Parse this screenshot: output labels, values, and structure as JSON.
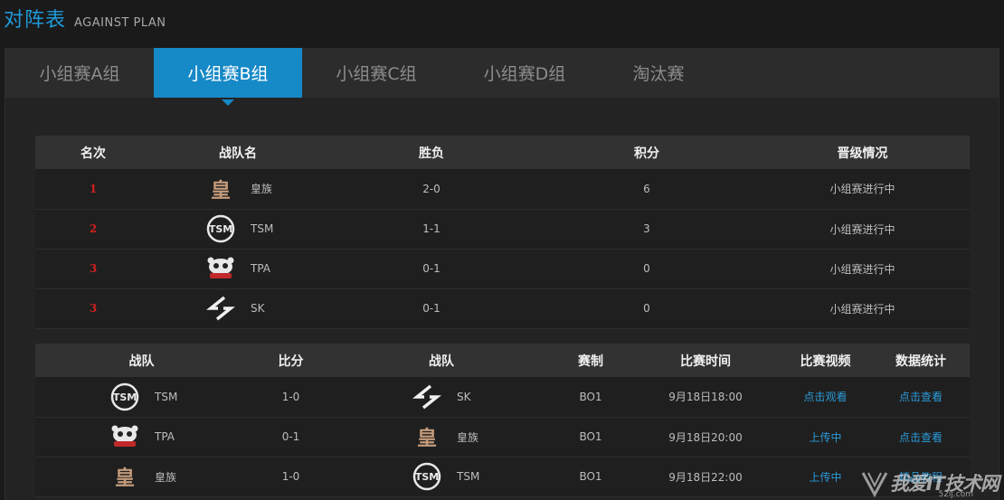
{
  "header": {
    "title": "对阵表",
    "subtitle": "AGAINST PLAN"
  },
  "tabs": [
    {
      "label": "小组赛A组",
      "active": false
    },
    {
      "label": "小组赛B组",
      "active": true
    },
    {
      "label": "小组赛C组",
      "active": false
    },
    {
      "label": "小组赛D组",
      "active": false
    },
    {
      "label": "淘汰赛",
      "active": false
    }
  ],
  "standings": {
    "headers": [
      "名次",
      "战队名",
      "胜负",
      "积分",
      "晋级情况"
    ],
    "rows": [
      {
        "rank": "1",
        "team": "皇族",
        "logo": "rng-logo-icon",
        "record": "2-0",
        "points": "6",
        "status": "小组赛进行中"
      },
      {
        "rank": "2",
        "team": "TSM",
        "logo": "tsm-logo-icon",
        "record": "1-1",
        "points": "3",
        "status": "小组赛进行中"
      },
      {
        "rank": "3",
        "team": "TPA",
        "logo": "tpa-logo-icon",
        "record": "0-1",
        "points": "0",
        "status": "小组赛进行中"
      },
      {
        "rank": "3",
        "team": "SK",
        "logo": "sk-logo-icon",
        "record": "0-1",
        "points": "0",
        "status": "小组赛进行中"
      }
    ]
  },
  "matches": {
    "headers": [
      "战队",
      "比分",
      "战队",
      "赛制",
      "比赛时间",
      "比赛视频",
      "数据统计"
    ],
    "rows": [
      {
        "team_a": "TSM",
        "logo_a": "tsm-logo-icon",
        "score": "1-0",
        "team_b": "SK",
        "logo_b": "sk-logo-icon",
        "format": "BO1",
        "time": "9月18日18:00",
        "video": "点击观看",
        "stats": "点击查看"
      },
      {
        "team_a": "TPA",
        "logo_a": "tpa-logo-icon",
        "score": "0-1",
        "team_b": "皇族",
        "logo_b": "rng-logo-icon",
        "format": "BO1",
        "time": "9月18日20:00",
        "video": "上传中",
        "stats": "点击查看"
      },
      {
        "team_a": "皇族",
        "logo_a": "rng-logo-icon",
        "score": "1-0",
        "team_b": "TSM",
        "logo_b": "tsm-logo-icon",
        "format": "BO1",
        "time": "9月18日22:00",
        "video": "上传中",
        "stats": "精品教程"
      }
    ]
  },
  "watermark": {
    "text": "我爱IT技术网",
    "url": "52ij.com"
  },
  "colors": {
    "accent": "#1689c7",
    "title": "#1e9ad8",
    "rank": "#d42020",
    "link": "#2a9ad8",
    "rng_logo": "#c39b7b"
  }
}
